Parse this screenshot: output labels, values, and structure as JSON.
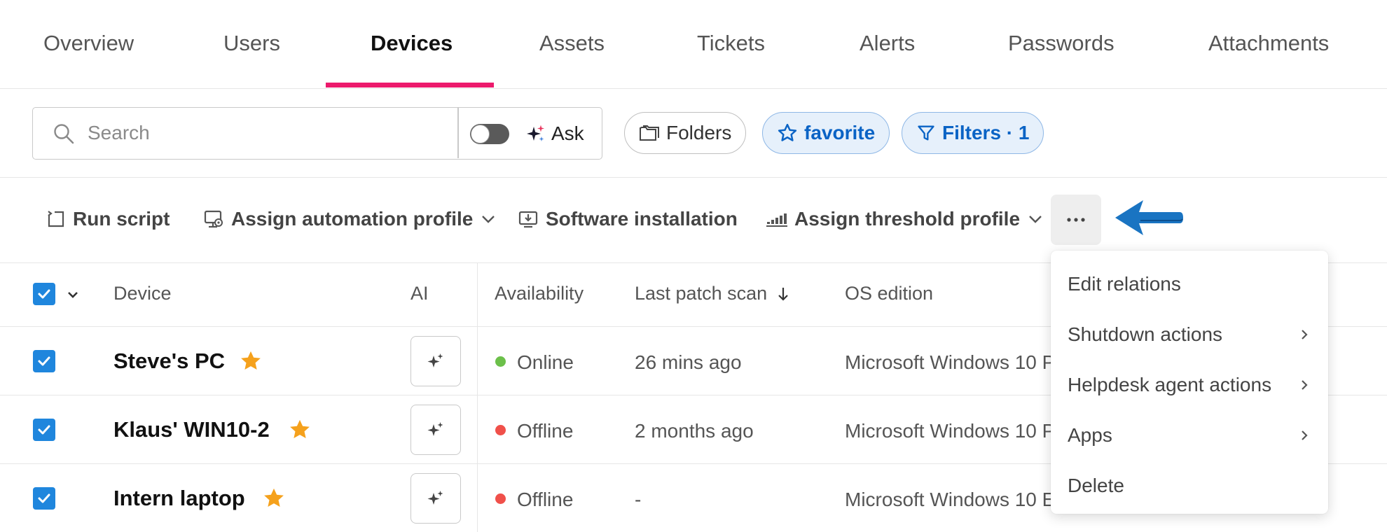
{
  "tabs": [
    {
      "label": "Overview",
      "active": false
    },
    {
      "label": "Users",
      "active": false
    },
    {
      "label": "Devices",
      "active": true
    },
    {
      "label": "Assets",
      "active": false
    },
    {
      "label": "Tickets",
      "active": false
    },
    {
      "label": "Alerts",
      "active": false
    },
    {
      "label": "Passwords",
      "active": false
    },
    {
      "label": "Attachments",
      "active": false
    }
  ],
  "search": {
    "placeholder": "Search",
    "value": "",
    "ask_label": "Ask",
    "ask_toggle_on": false
  },
  "filters": {
    "folders_label": "Folders",
    "favorite_label": "favorite",
    "filters_label": "Filters · 1"
  },
  "actions": {
    "run_script": "Run script",
    "assign_automation_profile": "Assign automation profile",
    "software_installation": "Software installation",
    "assign_threshold_profile": "Assign threshold profile",
    "more_label": "···"
  },
  "table": {
    "headers": {
      "device": "Device",
      "ai": "AI",
      "availability": "Availability",
      "last_patch_scan": "Last patch scan",
      "os_edition": "OS edition"
    },
    "rows": [
      {
        "name": "Steve's PC",
        "favorite": true,
        "availability": "Online",
        "last_patch_scan": "26 mins ago",
        "os_edition": "Microsoft Windows 10 P",
        "selected": true
      },
      {
        "name": "Klaus' WIN10-2",
        "favorite": true,
        "availability": "Offline",
        "last_patch_scan": "2 months ago",
        "os_edition": "Microsoft Windows 10 P",
        "selected": true
      },
      {
        "name": "Intern laptop",
        "favorite": true,
        "availability": "Offline",
        "last_patch_scan": "-",
        "os_edition": "Microsoft Windows 10 E",
        "selected": true
      }
    ]
  },
  "menu": {
    "items": [
      {
        "label": "Edit relations",
        "has_submenu": false
      },
      {
        "label": "Shutdown actions",
        "has_submenu": true
      },
      {
        "label": "Helpdesk agent actions",
        "has_submenu": true
      },
      {
        "label": "Apps",
        "has_submenu": true
      },
      {
        "label": "Delete",
        "has_submenu": false
      }
    ]
  },
  "colors": {
    "accent_pink": "#ec1a6c",
    "primary_blue": "#1f86dd",
    "chip_blue_text": "#0a63c5",
    "chip_blue_bg": "#e6f0fb",
    "star_orange": "#f5a11c",
    "online_green": "#6cc04a",
    "offline_red": "#f0504a",
    "annotation_arrow": "#1a74c2"
  }
}
